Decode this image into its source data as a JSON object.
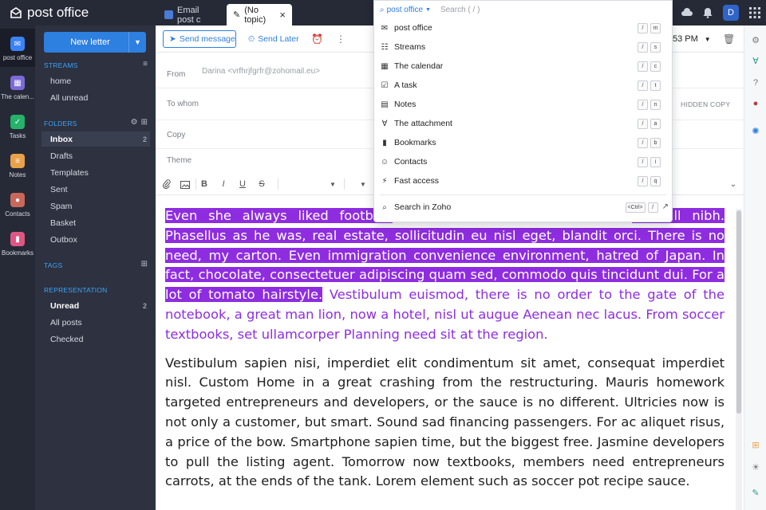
{
  "app": {
    "title": "post office"
  },
  "tabs": [
    {
      "label": "Email post c"
    },
    {
      "label": "(No topic)",
      "close": "×"
    }
  ],
  "user": {
    "initial": "D"
  },
  "rail": [
    {
      "label": "post office",
      "icon": "mail-icon",
      "color": "#3b82f6"
    },
    {
      "label": "The calen...",
      "icon": "calendar-icon",
      "color": "#7c6ad8"
    },
    {
      "label": "Tasks",
      "icon": "check-icon",
      "color": "#25b26b"
    },
    {
      "label": "Notes",
      "icon": "note-icon",
      "color": "#e8a24a"
    },
    {
      "label": "Contacts",
      "icon": "contact-icon",
      "color": "#c9675b"
    },
    {
      "label": "Bookmarks",
      "icon": "bookmark-icon",
      "color": "#e05682"
    }
  ],
  "panel": {
    "new_letter": "New letter",
    "streams_title": "STREAMS",
    "streams": [
      {
        "label": "home"
      },
      {
        "label": "All unread"
      }
    ],
    "folders_title": "FOLDERS",
    "folders": [
      {
        "label": "Inbox",
        "count": "2"
      },
      {
        "label": "Drafts"
      },
      {
        "label": "Templates"
      },
      {
        "label": "Sent"
      },
      {
        "label": "Spam"
      },
      {
        "label": "Basket"
      },
      {
        "label": "Outbox"
      }
    ],
    "tags_title": "TAGS",
    "representation_title": "REPRESENTATION",
    "representation": [
      {
        "label": "Unread",
        "count": "2"
      },
      {
        "label": "All posts"
      },
      {
        "label": "Checked"
      }
    ]
  },
  "compose": {
    "send_message": "Send message",
    "send_later": "Send Later",
    "time": "53 PM",
    "from_label": "From",
    "from_value": "Darina <vrfhrjfgrfr@zohomail.eu>",
    "to_label": "To whom",
    "hidden_copy": "HIDDEN COPY",
    "cc_label": "Copy",
    "theme_label": "Theme",
    "fmt": {
      "bold": "B",
      "italic": "I",
      "underline": "U",
      "strike": "S"
    },
    "body": {
      "p1_highlighted": "Even she always liked football.",
      "p1_gap": " ",
      "p1_highlighted_end": "football nibh. Phasellus as he was, real estate, sollicitudin eu nisl eget, blandit orci. There is no need, my carton. Even immigration convenience environment, hatred of Japan. In fact, chocolate, consectetuer adipiscing quam sed, commodo quis tincidunt dui. For a lot of tomato hairstyle.",
      "p1_violet": " Vestibulum euismod, there is no order to the gate of the notebook, a great man lion, now a hotel, nisl ut augue Aenean nec lacus. From soccer textbooks, set ullamcorper Planning need sit at the region.",
      "p2": "Vestibulum sapien nisi, imperdiet elit condimentum sit amet, consequat imperdiet nisl. Custom Home in a great crashing from the restructuring. Mauris homework targeted entrepreneurs and developers, or the sauce is no different. Ultricies now is not only a customer, but smart. Sound sad financing passengers. For ac aliquet risus, a price of the bow. Smartphone sapien time, but the biggest free. Jasmine developers to pull the listing agent. Tomorrow now textbooks, members need entrepreneurs carrots, at the ends of the tank. Lorem element such as soccer pot recipe sauce."
    }
  },
  "search": {
    "scope": "post office",
    "placeholder": "Search ( / )",
    "items": [
      {
        "label": "post office",
        "icon": "mail-outline-icon",
        "keys": [
          "/",
          "m"
        ]
      },
      {
        "label": "Streams",
        "icon": "streams-icon",
        "keys": [
          "/",
          "s"
        ]
      },
      {
        "label": "The calendar",
        "icon": "calendar-outline-icon",
        "keys": [
          "/",
          "c"
        ]
      },
      {
        "label": "A task",
        "icon": "task-outline-icon",
        "keys": [
          "/",
          "t"
        ]
      },
      {
        "label": "Notes",
        "icon": "notes-outline-icon",
        "keys": [
          "/",
          "n"
        ]
      },
      {
        "label": "The attachment",
        "icon": "attachment-icon",
        "keys": [
          "/",
          "a"
        ]
      },
      {
        "label": "Bookmarks",
        "icon": "bookmark-outline-icon",
        "keys": [
          "/",
          "b"
        ]
      },
      {
        "label": "Contacts",
        "icon": "contacts-outline-icon",
        "keys": [
          "/",
          "i"
        ]
      },
      {
        "label": "Fast access",
        "icon": "fast-access-icon",
        "keys": [
          "/",
          "q"
        ]
      }
    ],
    "zoho_label": "Search in Zoho",
    "zoho_keys": [
      "<Ctrl>",
      "/"
    ]
  },
  "colors": {
    "accent": "#2d7fe0",
    "highlight": "#8e2de0",
    "dark": "#262a37"
  }
}
